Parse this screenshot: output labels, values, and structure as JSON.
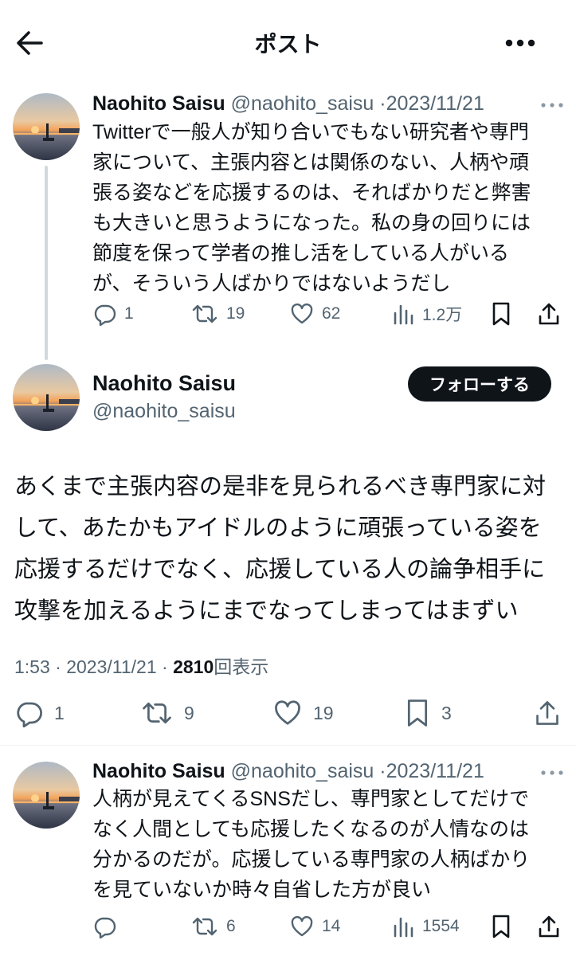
{
  "header": {
    "title": "ポスト",
    "back_icon": "arrow-left-icon",
    "more_icon": "more-horizontal-icon"
  },
  "tweets": [
    {
      "name": "Naohito Saisu",
      "handle": "@naohito_saisu",
      "dot": "·",
      "date": "2023/11/21",
      "text": "Twitterで一般人が知り合いでもない研究者や専門\n家について、主張内容とは関係のない、人柄や頑\n張る姿などを応援するのは、そればかりだと弊害\nも大きいと思うようになった。私の身の回りには\n節度を保って学者の推し活をしている人がいる\nが、そういう人ばかりではないようだし",
      "replies": "1",
      "retweets": "19",
      "likes": "62",
      "views": "1.2万"
    },
    {
      "name": "Naohito Saisu",
      "handle": "@naohito_saisu",
      "dot": "·",
      "date": "2023/11/21",
      "text": "人柄が見えてくるSNSだし、専門家としてだけで\nなく人間としても応援したくなるのが人情なのは\n分かるのだが。応援している専門家の人柄ばかり\nを見ていないか時々自省した方が良い",
      "replies": "",
      "retweets": "6",
      "likes": "14",
      "views": "1554"
    }
  ],
  "main_post": {
    "name": "Naohito Saisu",
    "handle": "@naohito_saisu",
    "follow_label": "フォローする",
    "text": "あくまで主張内容の是非を見られるべき専門家に対\nして、あたかもアイドルのように頑張っている姿を\n応援するだけでなく、応援している人の論争相手に\n攻撃を加えるようにまでなってしまってはまずい",
    "time": "1:53",
    "sep1": "·",
    "date": "2023/11/21",
    "sep2": "·",
    "views_count": "2810",
    "views_label": "回表示",
    "replies": "1",
    "retweets": "9",
    "likes": "19",
    "bookmarks": "3"
  },
  "icons": {
    "reply": "reply-icon",
    "retweet": "retweet-icon",
    "like": "heart-icon",
    "views": "analytics-icon",
    "bookmark": "bookmark-icon",
    "share": "share-icon"
  },
  "colors": {
    "text": "#0f1419",
    "secondary": "#536471",
    "thread_line": "#cfd9de",
    "divider": "#eff3f4",
    "button": "#0f1419"
  }
}
